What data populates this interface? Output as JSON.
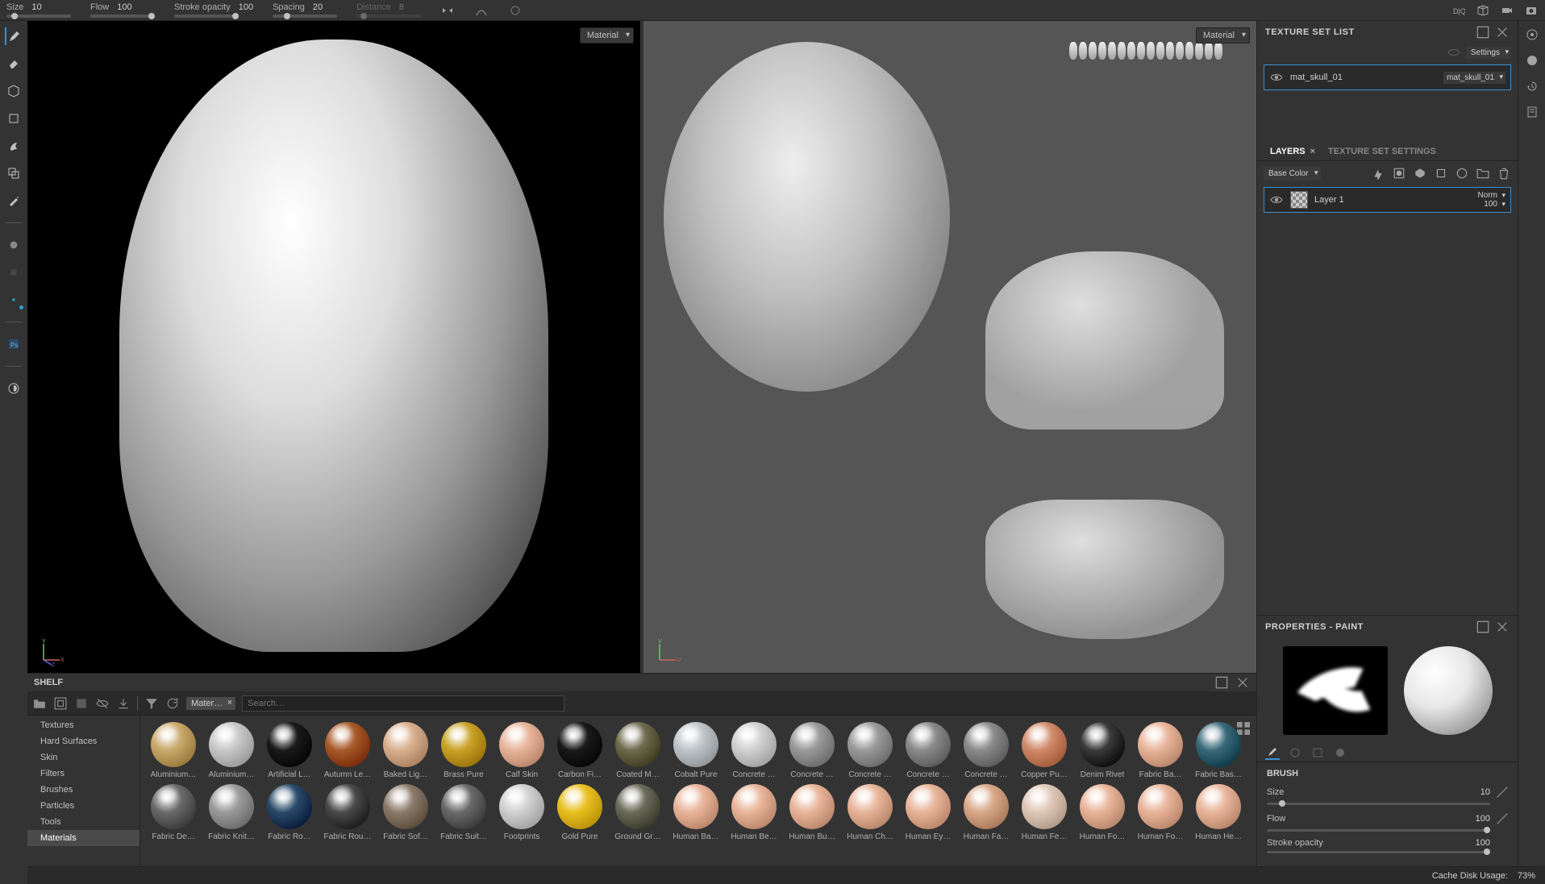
{
  "topbar": {
    "size": {
      "label": "Size",
      "value": "10"
    },
    "flow": {
      "label": "Flow",
      "value": "100"
    },
    "strokeOpacity": {
      "label": "Stroke opacity",
      "value": "100"
    },
    "spacing": {
      "label": "Spacing",
      "value": "20"
    },
    "distance": {
      "label": "Distance",
      "value": "8"
    }
  },
  "viewport": {
    "left": {
      "mode": "Material"
    },
    "right": {
      "mode": "Material"
    }
  },
  "textureSetList": {
    "title": "TEXTURE SET LIST",
    "settingsLabel": "Settings",
    "items": [
      {
        "name": "mat_skull_01",
        "link": "mat_skull_01"
      }
    ]
  },
  "layers": {
    "tabs": {
      "layers": "LAYERS",
      "settings": "TEXTURE SET SETTINGS"
    },
    "channel": "Base Color",
    "items": [
      {
        "name": "Layer 1",
        "blend": "Norm",
        "opacity": "100"
      }
    ]
  },
  "properties": {
    "title": "PROPERTIES - PAINT",
    "brushSection": "BRUSH",
    "size": {
      "label": "Size",
      "value": "10"
    },
    "flow": {
      "label": "Flow",
      "value": "100"
    },
    "strokeOpacity": {
      "label": "Stroke opacity",
      "value": "100"
    }
  },
  "shelf": {
    "title": "SHELF",
    "filterChip": "Mater…",
    "searchPlaceholder": "Search…",
    "categories": [
      "Textures",
      "Hard Surfaces",
      "Skin",
      "Filters",
      "Brushes",
      "Particles",
      "Tools",
      "Materials"
    ],
    "activeCategory": "Materials",
    "materials": [
      {
        "name": "Aluminium…",
        "color": "#c9a86b"
      },
      {
        "name": "Aluminium…",
        "color": "#c8c8c8"
      },
      {
        "name": "Artificial L…",
        "color": "#1a1a1a"
      },
      {
        "name": "Autumn Le…",
        "color": "#a85a2a"
      },
      {
        "name": "Baked Lig…",
        "color": "#d9b08f"
      },
      {
        "name": "Brass Pure",
        "color": "#c9a227"
      },
      {
        "name": "Calf Skin",
        "color": "#e8b49a"
      },
      {
        "name": "Carbon Fi…",
        "color": "#1a1a1a"
      },
      {
        "name": "Coated M…",
        "color": "#6e6a4e"
      },
      {
        "name": "Cobalt Pure",
        "color": "#bfc4c8"
      },
      {
        "name": "Concrete …",
        "color": "#d0d0d0"
      },
      {
        "name": "Concrete …",
        "color": "#9a9a9a"
      },
      {
        "name": "Concrete …",
        "color": "#9a9a9a"
      },
      {
        "name": "Concrete …",
        "color": "#8a8a8a"
      },
      {
        "name": "Concrete …",
        "color": "#8a8a8a"
      },
      {
        "name": "Copper Pu…",
        "color": "#d08a6a"
      },
      {
        "name": "Denim Rivet",
        "color": "#3a3a3a"
      },
      {
        "name": "Fabric Ba…",
        "color": "#e8b49a"
      },
      {
        "name": "Fabric Bas…",
        "color": "#3a6a7a"
      },
      {
        "name": "Fabric De…",
        "color": "#6a6a6a"
      },
      {
        "name": "Fabric Knit…",
        "color": "#9a9a9a"
      },
      {
        "name": "Fabric Ro…",
        "color": "#2a4a6a"
      },
      {
        "name": "Fabric Rou…",
        "color": "#4a4a4a"
      },
      {
        "name": "Fabric Sof…",
        "color": "#8a7a6a"
      },
      {
        "name": "Fabric Suit…",
        "color": "#6a6a6a"
      },
      {
        "name": "Footprints",
        "color": "#d0d0d0"
      },
      {
        "name": "Gold Pure",
        "color": "#e8c020"
      },
      {
        "name": "Ground Gr…",
        "color": "#6a6a5a"
      },
      {
        "name": "Human Ba…",
        "color": "#e8b49a"
      },
      {
        "name": "Human Be…",
        "color": "#e8b49a"
      },
      {
        "name": "Human Bu…",
        "color": "#e8b49a"
      },
      {
        "name": "Human Ch…",
        "color": "#e8b49a"
      },
      {
        "name": "Human Ey…",
        "color": "#e8b49a"
      },
      {
        "name": "Human Fa…",
        "color": "#d8a888"
      },
      {
        "name": "Human Fe…",
        "color": "#e0c8b8"
      },
      {
        "name": "Human Fo…",
        "color": "#e8b49a"
      },
      {
        "name": "Human Fo…",
        "color": "#e8b49a"
      },
      {
        "name": "Human He…",
        "color": "#e8b49a"
      }
    ]
  },
  "status": {
    "cacheLabel": "Cache Disk Usage:",
    "cacheValue": "73%"
  }
}
